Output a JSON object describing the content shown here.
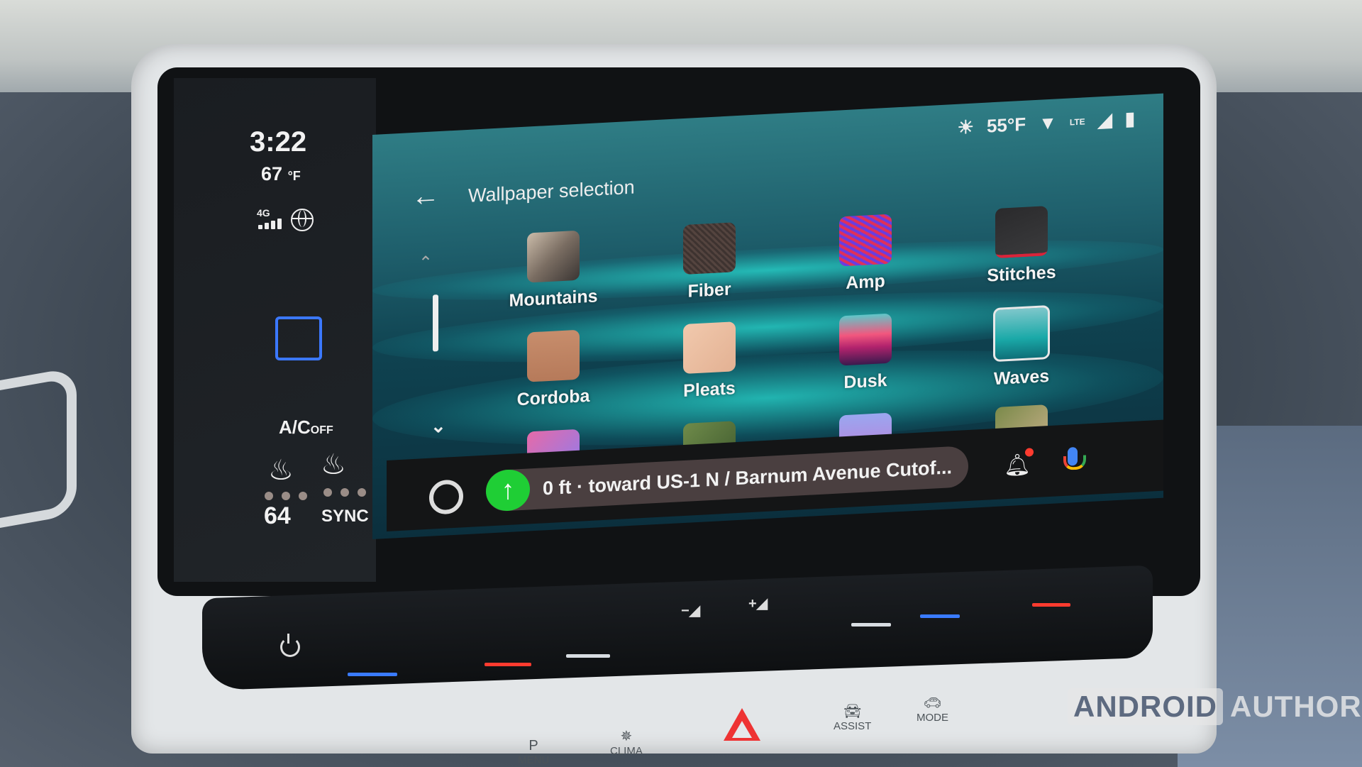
{
  "cluster": {
    "time": "3:22",
    "outside_temp": "67",
    "outside_temp_unit": "°F",
    "network_type": "4G",
    "signal_bars": 4,
    "ac_label": "A/C",
    "ac_state": "OFF",
    "cabin_temp": "64",
    "sync_label": "SYNC"
  },
  "status_bar": {
    "weather_icon": "sun-icon",
    "temperature": "55°F",
    "network_label": "LTE"
  },
  "header": {
    "back_icon": "arrow-left-icon",
    "title": "Wallpaper selection"
  },
  "scroll": {
    "up_icon": "chevron-up-icon",
    "down_icon": "chevron-down-icon"
  },
  "wallpapers": [
    {
      "label": "Mountains"
    },
    {
      "label": "Fiber"
    },
    {
      "label": "Amp"
    },
    {
      "label": "Stitches"
    },
    {
      "label": "Cordoba"
    },
    {
      "label": "Pleats"
    },
    {
      "label": "Dusk"
    },
    {
      "label": "Waves",
      "selected": true
    },
    {
      "label": ""
    },
    {
      "label": ""
    },
    {
      "label": ""
    },
    {
      "label": ""
    }
  ],
  "navbar": {
    "navigation_text": "0 ft · toward US-1 N / Barnum Avenue Cutof...",
    "nav_direction_icon": "arrow-up-icon",
    "notification_icon": "bell-icon",
    "voice_icon": "microphone-icon"
  },
  "hardware_buttons": {
    "menu": "MENU",
    "menu_glyph": "P",
    "clima": "CLIMA",
    "assist": "ASSIST",
    "mode": "MODE"
  },
  "watermark": {
    "part1": "ANDROID",
    "part2": "AUTHORITY"
  }
}
